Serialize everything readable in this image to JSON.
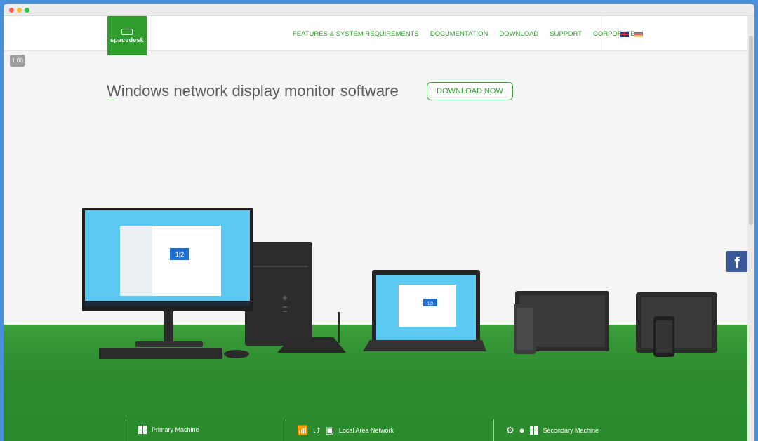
{
  "nav": {
    "logo_text": "spacedesk",
    "links": [
      "FEATURES & SYSTEM REQUIREMENTS",
      "DOCUMENTATION",
      "DOWNLOAD",
      "SUPPORT",
      "CORPORATE"
    ],
    "languages": [
      "English",
      "German"
    ]
  },
  "zoom_badge": "1.00",
  "hero": {
    "headline": "Windows network display monitor software",
    "cta_label": "DOWNLOAD NOW"
  },
  "scene": {
    "monitor_screen_text": "1|2",
    "laptop_screen_text": "1|2"
  },
  "social": {
    "facebook_label": "f"
  },
  "bottom_bar": {
    "primary": "Primary Machine",
    "network": "Local Area Network",
    "secondary": "Secondary Machine"
  },
  "colors": {
    "brand_green": "#2f9e2f",
    "floor_green": "#2e8c2f",
    "screen_blue": "#5ac8f0",
    "facebook_blue": "#3b5998"
  },
  "icons": [
    "windows-icon",
    "wifi-icon",
    "usb-icon",
    "lan-icon",
    "android-icon",
    "apple-icon",
    "facebook-icon"
  ]
}
